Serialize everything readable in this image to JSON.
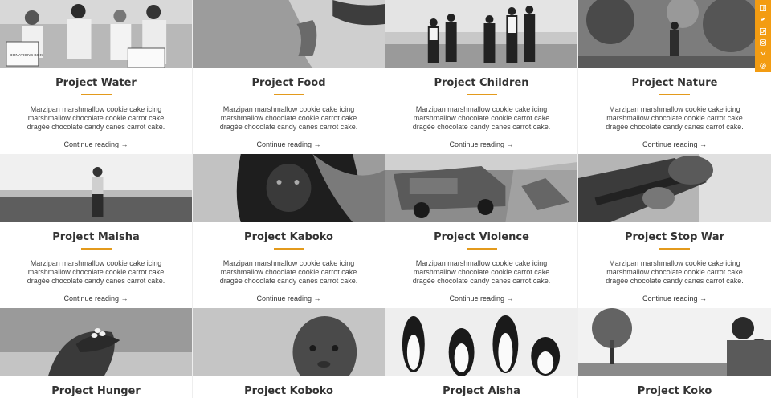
{
  "projects": [
    {
      "title": "Project Water",
      "excerpt": "Marzipan marshmallow cookie cake icing marshmallow chocolate cookie carrot cake dragée chocolate candy canes carrot cake.",
      "more": "Continue reading →",
      "scene": "volunteers",
      "label": "DONATIONS BOX"
    },
    {
      "title": "Project Food",
      "excerpt": "Marzipan marshmallow cookie cake icing marshmallow chocolate cookie carrot cake dragée chocolate candy canes carrot cake.",
      "more": "Continue reading →",
      "scene": "hands-soil"
    },
    {
      "title": "Project Children",
      "excerpt": "Marzipan marshmallow cookie cake icing marshmallow chocolate cookie carrot cake dragée chocolate candy canes carrot cake.",
      "more": "Continue reading →",
      "scene": "children-group"
    },
    {
      "title": "Project Nature",
      "excerpt": "Marzipan marshmallow cookie cake icing marshmallow chocolate cookie carrot cake dragée chocolate candy canes carrot cake.",
      "more": "Continue reading →",
      "scene": "forest"
    },
    {
      "title": "Project Maisha",
      "excerpt": "Marzipan marshmallow cookie cake icing marshmallow chocolate cookie carrot cake dragée chocolate candy canes carrot cake.",
      "more": "Continue reading →",
      "scene": "boy-field"
    },
    {
      "title": "Project Kaboko",
      "excerpt": "Marzipan marshmallow cookie cake icing marshmallow chocolate cookie carrot cake dragée chocolate candy canes carrot cake.",
      "more": "Continue reading →",
      "scene": "gorilla"
    },
    {
      "title": "Project Violence",
      "excerpt": "Marzipan marshmallow cookie cake icing marshmallow chocolate cookie carrot cake dragée chocolate candy canes carrot cake.",
      "more": "Continue reading →",
      "scene": "wreck"
    },
    {
      "title": "Project Stop War",
      "excerpt": "Marzipan marshmallow cookie cake icing marshmallow chocolate cookie carrot cake dragée chocolate candy canes carrot cake.",
      "more": "Continue reading →",
      "scene": "soldier"
    },
    {
      "title": "Project Hunger",
      "excerpt": "",
      "more": "",
      "scene": "hands-beans"
    },
    {
      "title": "Project Koboko",
      "excerpt": "",
      "more": "",
      "scene": "child-face"
    },
    {
      "title": "Project Aisha",
      "excerpt": "",
      "more": "",
      "scene": "penguins"
    },
    {
      "title": "Project Koko",
      "excerpt": "",
      "more": "",
      "scene": "tree-kids"
    }
  ],
  "social": [
    {
      "icon": "facebook-icon"
    },
    {
      "icon": "twitter-icon"
    },
    {
      "icon": "google-plus-icon"
    },
    {
      "icon": "instagram-icon"
    },
    {
      "icon": "vimeo-icon"
    },
    {
      "icon": "pinterest-icon"
    }
  ],
  "colors": {
    "accent": "#f39c12",
    "rule": "#e39a1c",
    "title": "#333333"
  }
}
